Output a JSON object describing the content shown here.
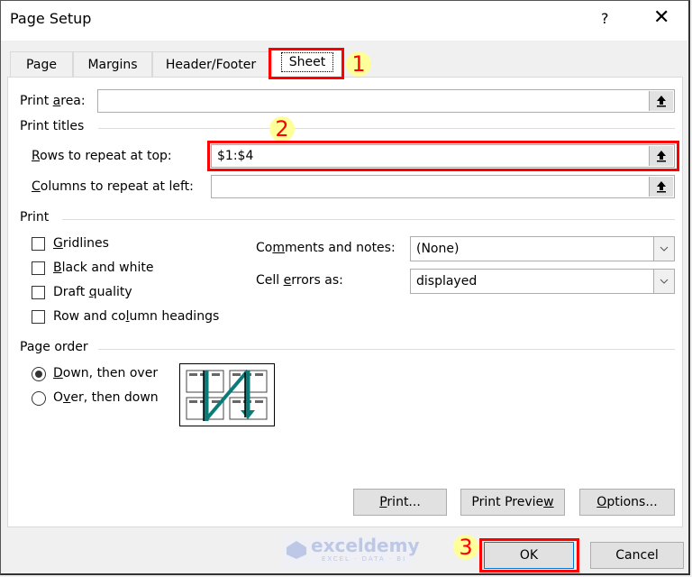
{
  "dialog": {
    "title": "Page Setup",
    "help_label": "?",
    "close_label": "✕"
  },
  "tabs": [
    {
      "label": "Page",
      "active": false
    },
    {
      "label": "Margins",
      "active": false
    },
    {
      "label": "Header/Footer",
      "active": false
    },
    {
      "label": "Sheet",
      "active": true
    }
  ],
  "sheet": {
    "print_area": {
      "label_pre": "Print ",
      "label_u": "a",
      "label_post": "rea:",
      "value": ""
    },
    "print_titles_heading": "Print titles",
    "rows_repeat": {
      "label_u": "R",
      "label_post": "ows to repeat at top:",
      "value": "$1:$4"
    },
    "cols_repeat": {
      "label_u": "C",
      "label_post": "olumns to repeat at left:",
      "value": ""
    },
    "print_heading": "Print",
    "checkboxes": [
      {
        "pre": "",
        "u": "G",
        "post": "ridlines",
        "checked": false
      },
      {
        "pre": "",
        "u": "B",
        "post": "lack and white",
        "checked": false
      },
      {
        "pre": "Draft ",
        "u": "q",
        "post": "uality",
        "checked": false
      },
      {
        "pre": "Row and co",
        "u": "l",
        "post": "umn headings",
        "checked": false
      }
    ],
    "comments": {
      "pre": "Co",
      "u": "m",
      "post": "ments and notes:",
      "value": "(None)"
    },
    "cell_errors": {
      "pre": "Cell ",
      "u": "e",
      "post": "rrors as:",
      "value": "displayed"
    },
    "page_order_heading": "Page order",
    "page_order": [
      {
        "pre": "",
        "u": "D",
        "post": "own, then over",
        "selected": true
      },
      {
        "pre": "O",
        "u": "v",
        "post": "er, then down",
        "selected": false
      }
    ]
  },
  "buttons": {
    "print": {
      "u": "P",
      "post": "rint..."
    },
    "print_preview": {
      "pre": "Print Previe",
      "u": "w"
    },
    "options": {
      "u": "O",
      "post": "ptions..."
    },
    "ok": "OK",
    "cancel": "Cancel"
  },
  "annotations": {
    "step1": "1",
    "step2": "2",
    "step3": "3",
    "highlight_color": "#ff0000",
    "marker_color": "#ffff99"
  },
  "watermark": {
    "name": "exceldemy",
    "tagline": "EXCEL · DATA · BI"
  }
}
